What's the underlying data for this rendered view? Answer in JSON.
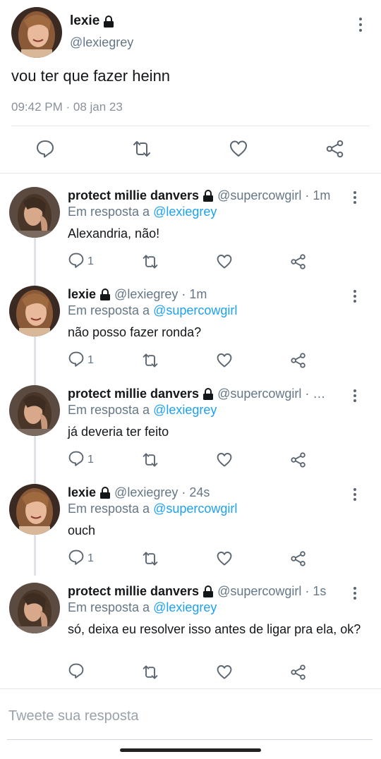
{
  "main_tweet": {
    "name": "lexie",
    "handle": "@lexiegrey",
    "text": "vou ter que fazer heinn",
    "timestamp": "09:42 PM · 08 jan 23",
    "protected": true
  },
  "replies": [
    {
      "name": "protect millie danvers",
      "meta": "@supercowgirl · 1m",
      "reply_label": "Em resposta a",
      "reply_to": "@lexiegrey",
      "text": "Alexandria, não!",
      "reply_count": "1",
      "avatar": "millie"
    },
    {
      "name": "lexie",
      "meta": "@lexiegrey · 1m",
      "reply_label": "Em resposta a",
      "reply_to": "@supercowgirl",
      "text": "não posso fazer ronda?",
      "reply_count": "1",
      "avatar": "lexie"
    },
    {
      "name": "protect millie danvers",
      "meta": "@supercowgirl · …",
      "reply_label": "Em resposta a",
      "reply_to": "@lexiegrey",
      "text": "já deveria ter feito",
      "reply_count": "1",
      "avatar": "millie"
    },
    {
      "name": "lexie",
      "meta": "@lexiegrey · 24s",
      "reply_label": "Em resposta a",
      "reply_to": "@supercowgirl",
      "text": "ouch",
      "reply_count": "1",
      "avatar": "lexie"
    },
    {
      "name": "protect millie danvers",
      "meta": "@supercowgirl · 1s",
      "reply_label": "Em resposta a",
      "reply_to": "@lexiegrey",
      "text": "só, deixa eu resolver isso antes de ligar pra ela, ok?",
      "reply_count": "",
      "avatar": "millie"
    }
  ],
  "compose": {
    "placeholder": "Tweete sua resposta"
  },
  "colors": {
    "accent": "#1da1f2",
    "secondary_text": "#657786",
    "icon": "#5b6670"
  },
  "icons": {
    "reply": "comment-icon",
    "retweet": "retweet-icon",
    "like": "heart-icon",
    "share": "share-icon",
    "lock": "lock-icon",
    "more": "more-vertical-icon"
  }
}
